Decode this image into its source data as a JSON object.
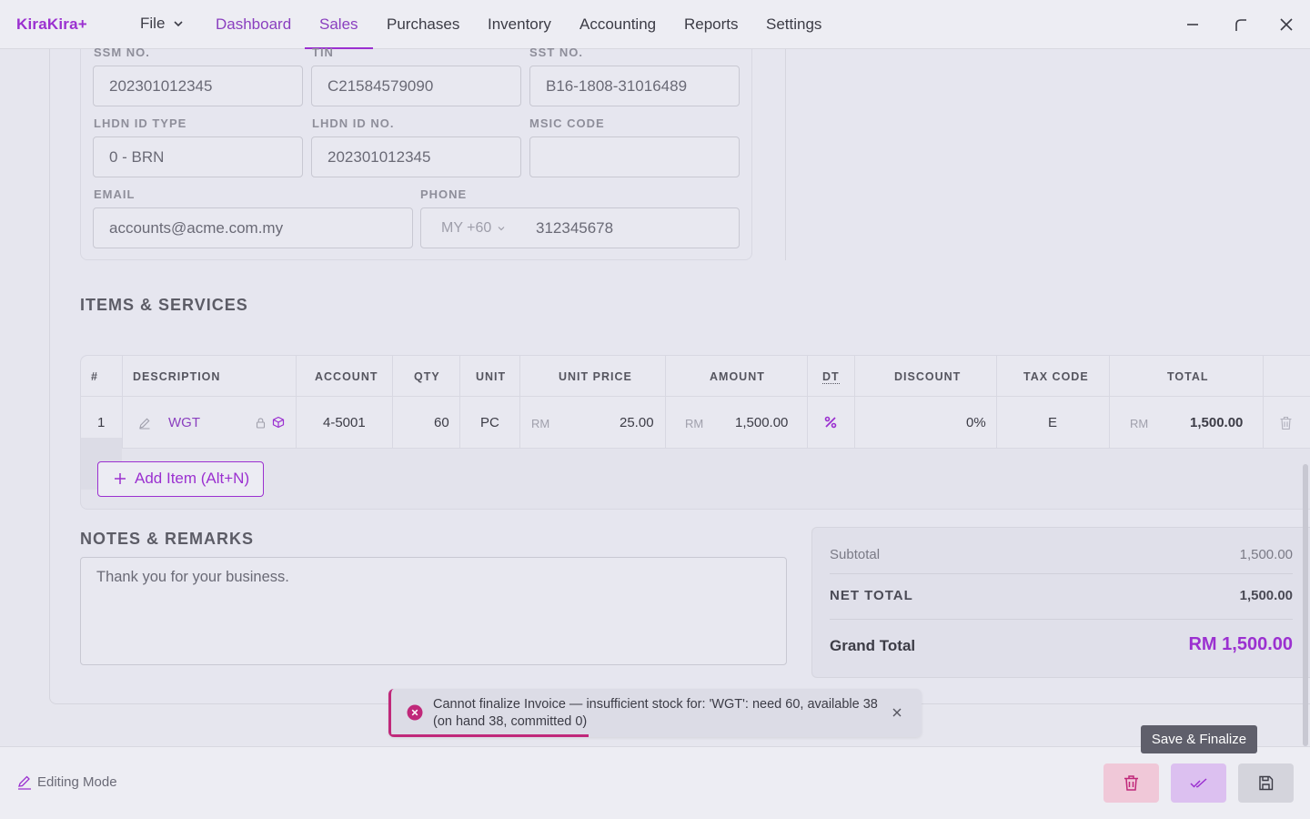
{
  "app": {
    "brand": "KiraKira+",
    "file_menu": "File"
  },
  "nav": [
    "Dashboard",
    "Sales",
    "Purchases",
    "Inventory",
    "Accounting",
    "Reports",
    "Settings"
  ],
  "customer": {
    "ssm_label": "SSM NO.",
    "ssm_value": "202301012345",
    "tin_label": "TIN",
    "tin_value": "C21584579090",
    "sst_label": "SST NO.",
    "sst_value": "B16-1808-31016489",
    "lhdn_type_label": "LHDN ID TYPE",
    "lhdn_type_value": "0 - BRN",
    "lhdn_no_label": "LHDN ID NO.",
    "lhdn_no_value": "202301012345",
    "msic_label": "MSIC CODE",
    "msic_value": "",
    "email_label": "EMAIL",
    "email_value": "accounts@acme.com.my",
    "phone_label": "PHONE",
    "phone_country": "MY +60",
    "phone_value": "312345678"
  },
  "items": {
    "title": "ITEMS & SERVICES",
    "headers": [
      "#",
      "DESCRIPTION",
      "ACCOUNT",
      "QTY",
      "UNIT",
      "UNIT PRICE",
      "AMOUNT",
      "DT",
      "DISCOUNT",
      "TAX CODE",
      "TOTAL"
    ],
    "row": {
      "num": "1",
      "description": "WGT",
      "account": "4-5001",
      "qty": "60",
      "unit": "PC",
      "currency": "RM",
      "unit_price": "25.00",
      "amount": "1,500.00",
      "discount": "0%",
      "tax_code": "E",
      "total": "1,500.00"
    },
    "add_label": "Add Item (Alt+N)"
  },
  "notes": {
    "title": "NOTES & REMARKS",
    "value": "Thank you for your business."
  },
  "totals": {
    "subtotal_label": "Subtotal",
    "subtotal_value": "1,500.00",
    "net_label": "NET TOTAL",
    "net_value": "1,500.00",
    "grand_label": "Grand Total",
    "grand_value": "RM 1,500.00"
  },
  "toast": {
    "message": "Cannot finalize Invoice — insufficient stock for: 'WGT': need 60, available 38 (on hand 38, committed 0)"
  },
  "footer": {
    "mode": "Editing Mode",
    "tooltip": "Save & Finalize"
  },
  "colors": {
    "accent": "#9b30d0",
    "error": "#c0287a",
    "delete_bg": "#f0c8d8",
    "finalize_bg": "#dcc0f0"
  }
}
